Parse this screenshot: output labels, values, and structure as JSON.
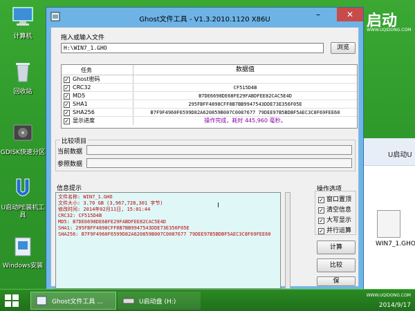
{
  "desktop": {
    "icons": [
      {
        "label": "计算机"
      },
      {
        "label": "回收站"
      },
      {
        "label": "GDISK快速分区"
      },
      {
        "label": "U启动PE装机工具"
      },
      {
        "label": "Windows安装"
      }
    ],
    "right_file": "WIN7_1.GHO",
    "bgwin_title": "U启动U",
    "logo_main": "启动",
    "logo_site": "WWW.UQIDONG.COM",
    "colors": {
      "desktop": "#2e9c2a",
      "titlebar": "#6db3e6",
      "info_text": "#c00000",
      "close": "#c74b4b"
    }
  },
  "taskbar": {
    "task1": "Ghost文件工具 ...",
    "task2": "U启动盘 (H:)",
    "clock_time": "",
    "clock_date": "2014/9/17"
  },
  "window": {
    "title": "Ghost文件工具 - V1.3.2010.1120 X86U",
    "min_icon": "minimize-icon",
    "max_icon": "maximize-icon",
    "close_icon": "close-icon",
    "drop_label": "拖入或输入文件",
    "file_path": "H:\\WIN7_1.GHO",
    "browse_label": "浏览",
    "grid": {
      "col_task": "任务",
      "col_value": "数据值",
      "rows": [
        {
          "task": "Ghost密码",
          "value": "",
          "checked": true
        },
        {
          "task": "CRC32",
          "value": "CF515D4B",
          "checked": true
        },
        {
          "task": "MD5",
          "value": "B7DE6698DE68FE29FABDFEE82CAC5E4D",
          "checked": true
        },
        {
          "task": "SHA1",
          "value": "295FBFF4898CFF8B7BB9947543DDE73E356F05E",
          "checked": true
        },
        {
          "task": "SHA256",
          "value": "B7F9F4960F6599D82A620859B007C0087677 79DEE97B5BDBF5AEC3C8F69FEE60",
          "checked": true
        },
        {
          "task": "显示进度",
          "value": "操作完成，耗时 445,960 毫秒。",
          "checked": true
        }
      ]
    },
    "compare": {
      "title": "比较项目",
      "current": "当前数据",
      "reference": "参照数据"
    },
    "info": {
      "title": "信息提示",
      "lines": [
        "文件名称: WIN7_1.GHO",
        "文件大小: 3.70 GB (3,967,728,301 字节)",
        "修改时间: 2014年02月11日, 15:01:44",
        "CRC32: CF515D4B",
        "MD5: B7DE6698DE68FE29FABDFEE82CAC5E4D",
        "SHA1: 295FBFF4898CFF8B7BB9947543DDE73E356F05E",
        "SHA256: B7F9F4960F6599D82A620859B007C0087677 79DEE97B5BDBF5AEC3C8F69FEE60"
      ]
    },
    "options": {
      "title": "操作选项",
      "items": [
        "窗口置顶",
        "清空信息",
        "大写显示",
        "并行运算"
      ]
    },
    "compute_label": "计算",
    "compare_label": "比较",
    "save_label": "保"
  }
}
